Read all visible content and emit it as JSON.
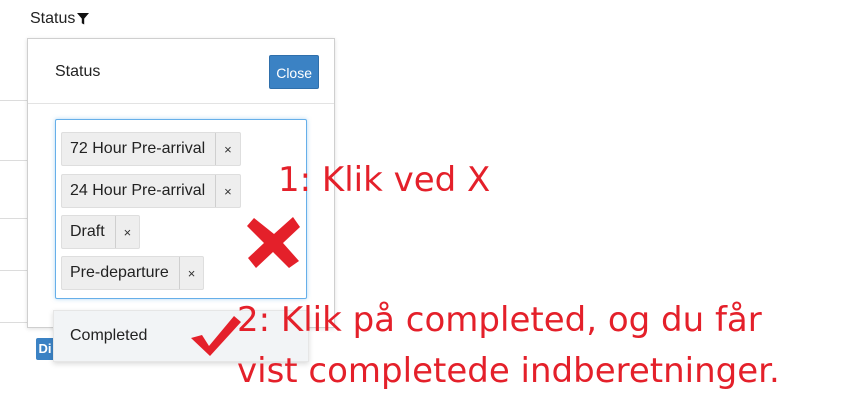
{
  "column_header": {
    "label": "Status",
    "icon": "filter-icon"
  },
  "background": {
    "button_fragment": "Di"
  },
  "panel": {
    "title": "Status",
    "close_label": "Close",
    "selected_tags": [
      {
        "label": "72 Hour Pre-arrival",
        "remove": "×"
      },
      {
        "label": "24 Hour Pre-arrival",
        "remove": "×"
      },
      {
        "label": "Draft",
        "remove": "×"
      },
      {
        "label": "Pre-departure",
        "remove": "×"
      }
    ],
    "dropdown_options": [
      "Completed"
    ]
  },
  "annotations": {
    "step1": "1: Klik ved X",
    "step2_line1": "2: Klik på completed, og du får",
    "step2_line2": "vist completede indberetninger."
  },
  "colors": {
    "accent_blue": "#3b82c4",
    "annotation_red": "#e4202a",
    "focus_border": "#66afe9"
  }
}
